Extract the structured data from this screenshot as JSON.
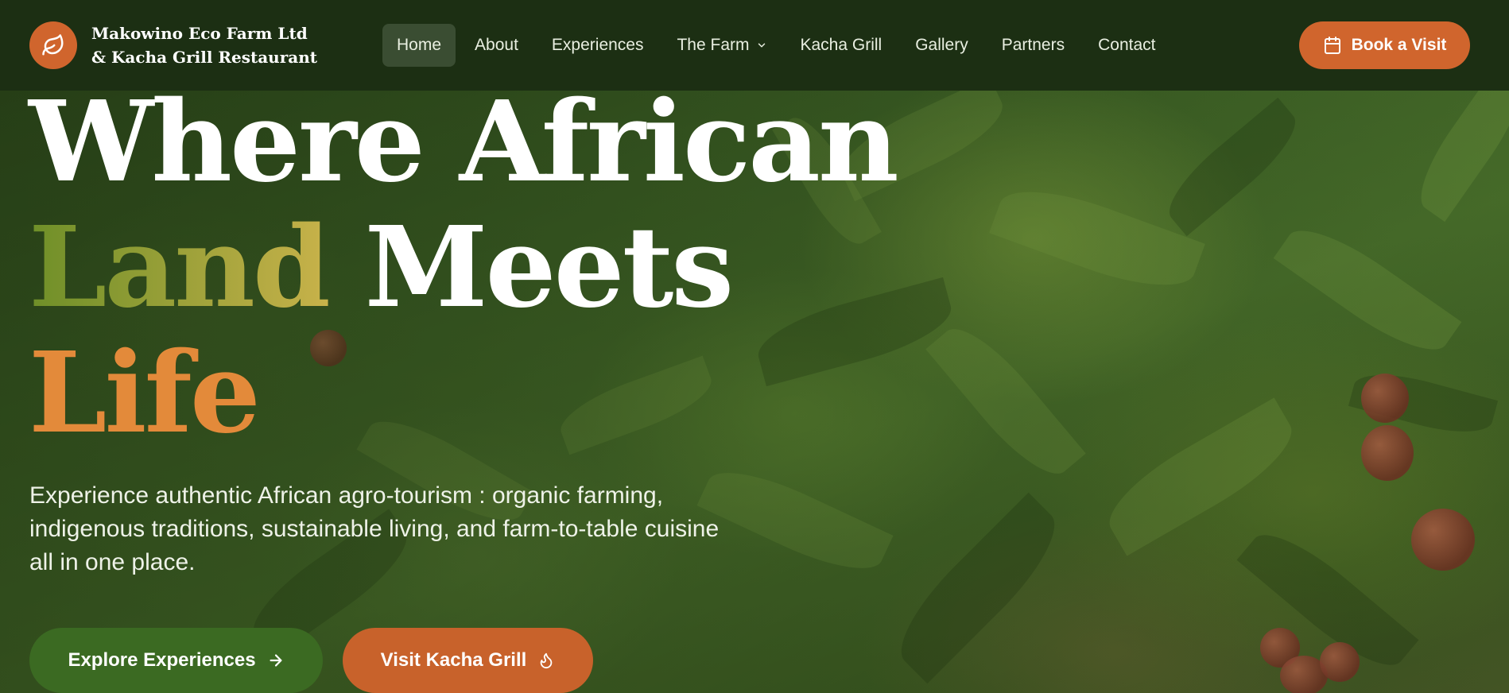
{
  "brand": {
    "name_line1": "Makowino Eco Farm Ltd",
    "name_line2": "& Kacha Grill Restaurant",
    "logo_icon": "leaf-icon",
    "accent_color": "#d0652d"
  },
  "nav": {
    "items": [
      {
        "label": "Home",
        "active": true
      },
      {
        "label": "About"
      },
      {
        "label": "Experiences"
      },
      {
        "label": "The Farm",
        "has_dropdown": true
      },
      {
        "label": "Kacha Grill"
      },
      {
        "label": "Gallery"
      },
      {
        "label": "Partners"
      },
      {
        "label": "Contact"
      }
    ],
    "book_button": {
      "label": "Book a Visit",
      "icon": "calendar-icon"
    }
  },
  "hero": {
    "headline": {
      "word1": "Where African",
      "word2_highlight": "Land",
      "word2_rest": "Meets",
      "word3": "Life"
    },
    "tagline": "Experience authentic African agro-tourism : organic farming, indigenous traditions, sustainable living, and farm-to-table cuisine all in one place.",
    "cta_primary": {
      "label": "Explore Experiences",
      "icon": "arrow-right-icon",
      "color": "#3b6a22"
    },
    "cta_secondary": {
      "label": "Visit Kacha Grill",
      "icon": "flame-icon",
      "color": "#c8622b"
    }
  }
}
